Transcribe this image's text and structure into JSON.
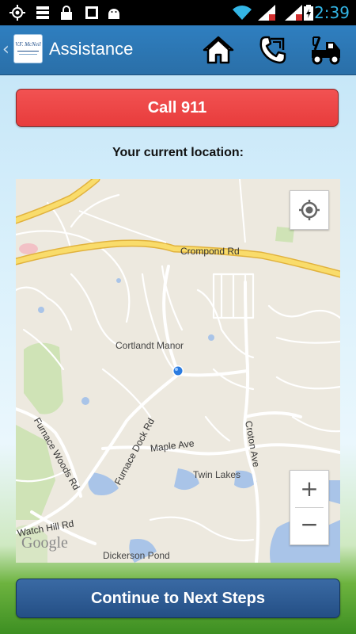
{
  "status_bar": {
    "time": "2:39",
    "icons": [
      "gps-icon",
      "storage-icon",
      "lock-icon",
      "debug-icon",
      "android-icon",
      "wifi-icon",
      "signal-icon",
      "battery-icon"
    ]
  },
  "header": {
    "title": "Assistance",
    "logo_text": "V.F. McNeil",
    "buttons": [
      "home-icon",
      "phone-icon",
      "tow-truck-icon"
    ]
  },
  "call_button": {
    "label": "Call 911"
  },
  "location": {
    "label": "Your current location:"
  },
  "map": {
    "labels": {
      "crompond": "Crompond Rd",
      "cortlandt": "Cortlandt Manor",
      "furnace_woods": "Furnace Woods Rd",
      "furnace_dock": "Furnace Dock Rd",
      "maple": "Maple Ave",
      "croton": "Croton Ave",
      "twin_lakes": "Twin Lakes",
      "watch_hill": "Watch Hill Rd",
      "dickerson": "Dickerson Pond"
    },
    "attribution": "Google",
    "controls": {
      "zoom_in": "+",
      "zoom_out": "−"
    }
  },
  "footer": {
    "continue_label": "Continue to Next Steps"
  },
  "colors": {
    "status_bar": "#000000",
    "action_bar": "#2f7fc0",
    "call_button": "#ee4545",
    "continue_button": "#2f5e96",
    "time": "#33b5e5"
  }
}
